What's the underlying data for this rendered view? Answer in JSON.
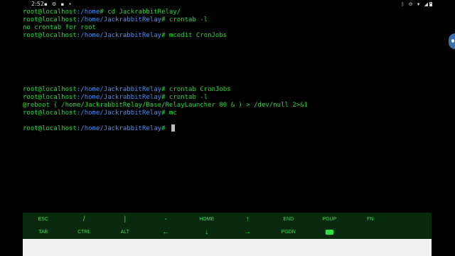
{
  "status_bar": {
    "time": "2:52",
    "notification_icons": "▪ ⚙ ▪ •",
    "system_icons": "ᛒ ⊖ ▾ ◢"
  },
  "terminal": {
    "lines": [
      {
        "user": "root@localhost",
        "path": ":/home",
        "cmd": "# cd JackrabbitRelay/"
      },
      {
        "user": "root@localhost",
        "path": ":/home/JackrabbitRelay",
        "cmd": "# crontab -l"
      },
      {
        "output": "no crontab for root"
      },
      {
        "user": "root@localhost",
        "path": ":/home/JackrabbitRelay",
        "cmd": "# mcedit CronJobs"
      },
      {
        "output": ""
      },
      {
        "output": ""
      },
      {
        "output": ""
      },
      {
        "output": ""
      },
      {
        "output": ""
      },
      {
        "output": ""
      },
      {
        "user": "root@localhost",
        "path": ":/home/JackrabbitRelay",
        "cmd": "# crontab CronJobs"
      },
      {
        "user": "root@localhost",
        "path": ":/home/JackrabbitRelay",
        "cmd": "# crontab -l"
      },
      {
        "output": "@reboot ( /home/JackrabbitRelay/Base/RelayLauncher 80 & ) > /dev/null 2>&1"
      },
      {
        "user": "root@localhost",
        "path": ":/home/JackrabbitRelay",
        "cmd": "# mc"
      },
      {
        "output": ""
      },
      {
        "user": "root@localhost",
        "path": ":/home/JackrabbitRelay",
        "cmd": "# ",
        "cursor": true
      }
    ],
    "colors": {
      "text": "#2bd83a",
      "path": "#4a8df0",
      "background": "#000000"
    }
  },
  "extra_keys": {
    "row1": [
      "ESC",
      "/",
      "|",
      "-",
      "HOME",
      "↑",
      "END",
      "PGUP",
      "FN",
      ""
    ],
    "row2": [
      "TAB",
      "CTRL",
      "ALT",
      "←",
      "↓",
      "→",
      "PGDN",
      "",
      "",
      ""
    ],
    "keyboard_icon": "keyboard-icon",
    "color": "#2ee04a",
    "background": "#0a2a10"
  }
}
